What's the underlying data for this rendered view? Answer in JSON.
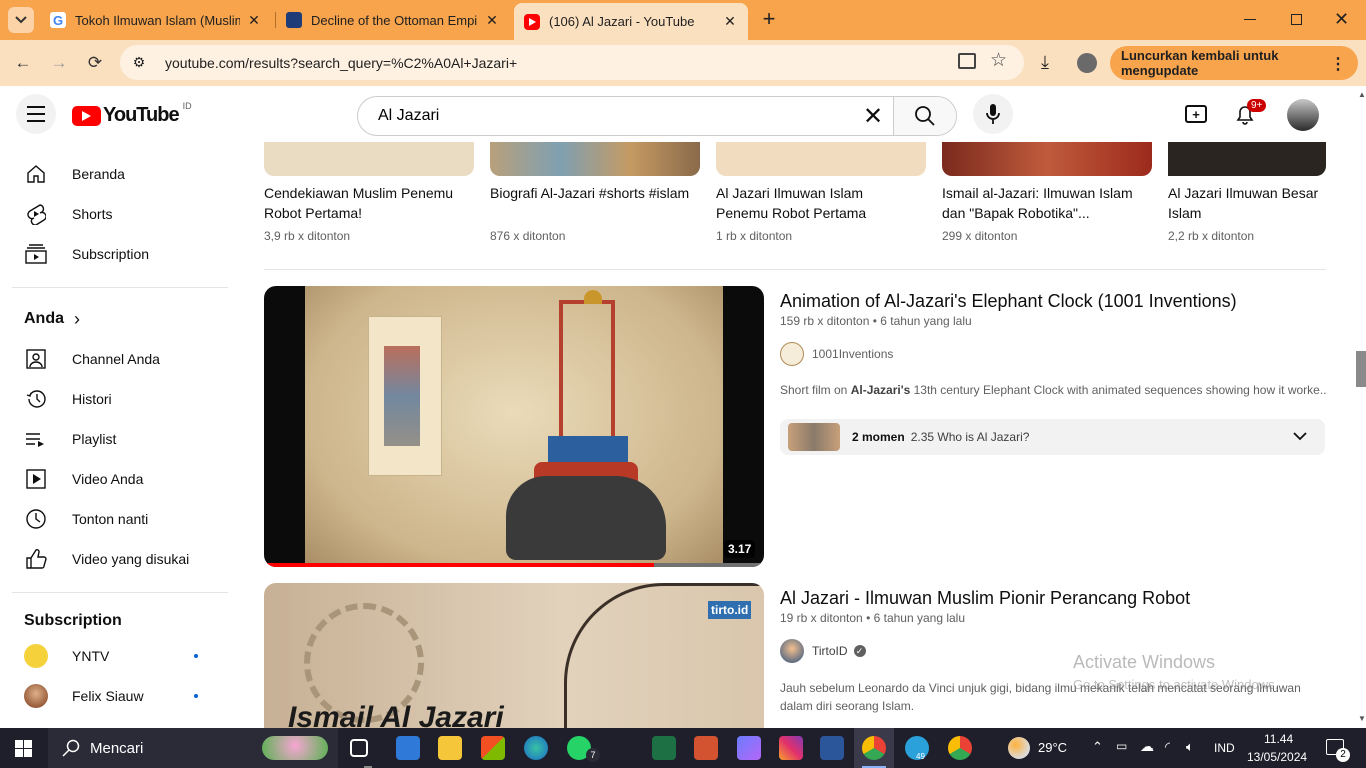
{
  "browser": {
    "tabs": [
      {
        "title": "Tokoh Ilmuwan Islam (Muslim)"
      },
      {
        "title": "Decline of the Ottoman Empire"
      },
      {
        "title": "(106)  Al Jazari - YouTube"
      }
    ],
    "url": "youtube.com/results?search_query=%C2%A0Al+Jazari+",
    "update_label": "Luncurkan kembali untuk mengupdate"
  },
  "yt": {
    "logo": "YouTube",
    "region": "ID",
    "search_value": "Al Jazari",
    "notif_count": "9+"
  },
  "sidebar": {
    "main": [
      {
        "label": "Beranda"
      },
      {
        "label": "Shorts"
      },
      {
        "label": "Subscription"
      }
    ],
    "you_header": "Anda",
    "you": [
      {
        "label": "Channel Anda"
      },
      {
        "label": "Histori"
      },
      {
        "label": "Playlist"
      },
      {
        "label": "Video Anda"
      },
      {
        "label": "Tonton nanti"
      },
      {
        "label": "Video yang disukai"
      }
    ],
    "subs_header": "Subscription",
    "subs": [
      {
        "label": "YNTV"
      },
      {
        "label": "Felix Siauw"
      }
    ]
  },
  "shorts": [
    {
      "title": "Cendekiawan Muslim Penemu Robot Pertama!",
      "views": "3,9 rb x ditonton"
    },
    {
      "title": "Biografi Al-Jazari #shorts #islam",
      "views": "876 x ditonton"
    },
    {
      "title": "Al Jazari Ilmuwan Islam Penemu Robot Pertama",
      "views": "1 rb x ditonton"
    },
    {
      "title": "Ismail al-Jazari: Ilmuwan Islam dan \"Bapak Robotika\"...",
      "views": "299 x ditonton"
    },
    {
      "title": "Al Jazari Ilmuwan Besar Islam",
      "views": "2,2 rb x ditonton"
    }
  ],
  "videos": [
    {
      "title": "Animation of Al-Jazari's Elephant Clock (1001 Inventions)",
      "views": "159 rb x ditonton",
      "age": "6 tahun yang lalu",
      "channel": "1001Inventions",
      "desc_pre": "Short film on ",
      "desc_bold": "Al-Jazari's",
      "desc_post": " 13th century Elephant Clock with animated sequences showing how it worke...",
      "duration": "3.17",
      "watched_fraction": 0.78,
      "moments_label": "2 momen",
      "moments_detail": "2.35 Who is Al Jazari?"
    },
    {
      "title": "Al Jazari - Ilmuwan Muslim Pionir Perancang Robot",
      "views": "19 rb x ditonton",
      "age": "6 tahun yang lalu",
      "channel": "TirtoID",
      "desc": "Jauh sebelum Leonardo da Vinci unjuk gigi, bidang ilmu mekanik telah mencatat seorang ilmuwan dalam diri seorang Islam.",
      "thumb_badge": "tirto.id",
      "thumb_text": "Ismail Al Jazari"
    }
  ],
  "watermark": {
    "line1": "Activate Windows",
    "line2": "Go to Settings to activate Windows."
  },
  "taskbar": {
    "search": "Mencari",
    "temp": "29°C",
    "lang": "IND",
    "time": "11.44",
    "date": "13/05/2024",
    "whatsapp_badge": "7",
    "telegram_badge": "49",
    "notif_count": "2"
  }
}
